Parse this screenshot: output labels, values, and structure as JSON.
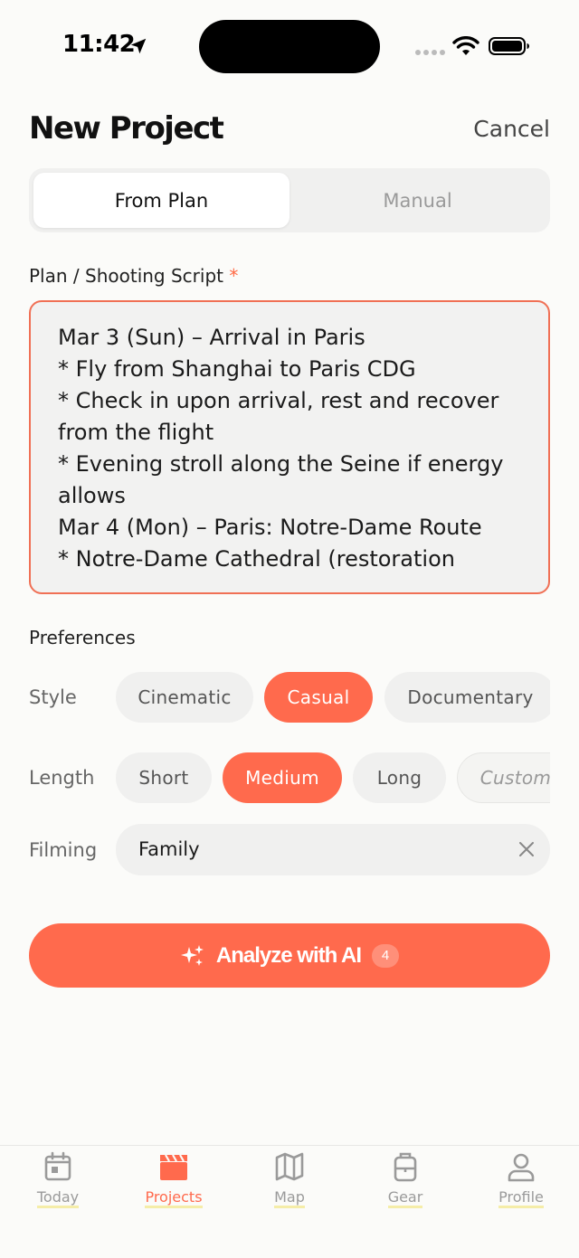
{
  "status_bar": {
    "time": "11:42"
  },
  "header": {
    "title": "New Project",
    "cancel_label": "Cancel"
  },
  "mode_tabs": [
    {
      "label": "From Plan",
      "selected": true
    },
    {
      "label": "Manual",
      "selected": false
    }
  ],
  "plan": {
    "label": "Plan / Shooting Script",
    "required_marker": "*",
    "text": "Mar 3 (Sun) – Arrival in Paris\n* Fly from Shanghai to Paris CDG\n* Check in upon arrival, rest and recover from the flight\n* Evening stroll along the Seine if energy allows\nMar 4 (Mon) – Paris: Notre-Dame Route\n* Notre-Dame Cathedral (restoration"
  },
  "preferences": {
    "label": "Preferences",
    "style": {
      "label": "Style",
      "options": [
        "Cinematic",
        "Casual",
        "Documentary"
      ],
      "selected": "Casual"
    },
    "length": {
      "label": "Length",
      "options": [
        "Short",
        "Medium",
        "Long",
        "Custom"
      ],
      "selected": "Medium"
    },
    "filming": {
      "label": "Filming",
      "value": "Family"
    }
  },
  "analyze_button": {
    "label": "Analyze with AI",
    "badge": "4"
  },
  "tabbar": [
    {
      "label": "Today",
      "icon": "calendar-icon",
      "active": false
    },
    {
      "label": "Projects",
      "icon": "clapperboard-icon",
      "active": true
    },
    {
      "label": "Map",
      "icon": "map-icon",
      "active": false
    },
    {
      "label": "Gear",
      "icon": "gear-bag-icon",
      "active": false
    },
    {
      "label": "Profile",
      "icon": "person-icon",
      "active": false
    }
  ],
  "colors": {
    "accent": "#FF6A4D",
    "background": "#FBFBF9",
    "chip_bg": "#F0F0EF",
    "error_border": "#F07055"
  }
}
